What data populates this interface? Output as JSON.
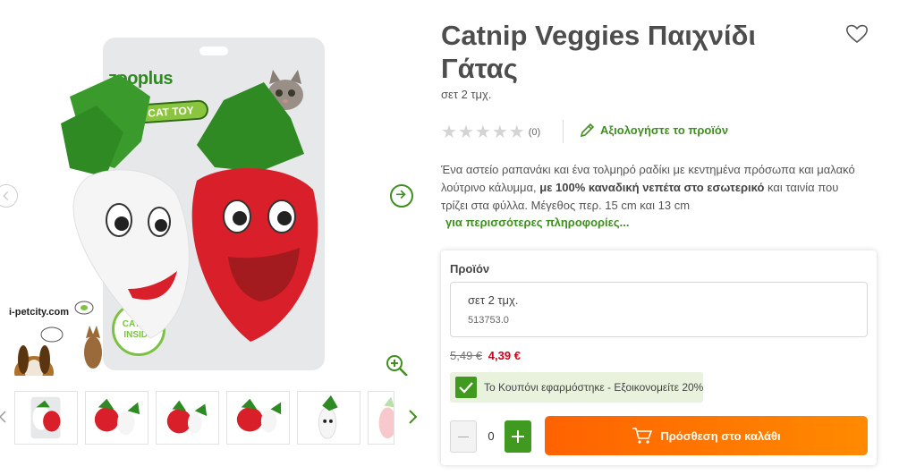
{
  "product": {
    "title": "Catnip Veggies Παιχνίδι Γάτας",
    "variant_subtitle": "σετ 2 τμχ.",
    "rating_count": "(0)",
    "review_link": "Αξιολογήστε το προϊόν",
    "description_part1": "Ένα αστείο ραπανάκι και ένα τολμηρό ραδίκι με κεντημένα πρόσωπα και μαλακό λούτρινο κάλυμμα, ",
    "description_bold": "με 100% καναδική νεπέτα στο εσωτερικό",
    "description_part2": " και ταινία που τρίζει στα φύλλα. Μέγεθος περ. 15 cm και 13 cm",
    "more_link": "για περισσότερες πληροφορίες..."
  },
  "image": {
    "brand_logo": "zooplus",
    "cat_toy_badge": "CAT TOY",
    "catnip_badge": "CATNIP INSIDE",
    "overlay_site": "i-petcity.com"
  },
  "buybox": {
    "label": "Προϊόν",
    "variant_name": "σετ 2 τμχ.",
    "variant_code": "513753.0",
    "price_old": "5,49 €",
    "price_new": "4,39 €",
    "coupon_text": "Το Κουπόνι εφαρμόστηκε - Εξοικονομείτε 20%",
    "quantity": "0",
    "add_to_cart": "Πρόσθεση στο καλάθι"
  },
  "colors": {
    "accent_green": "#3f8f1f",
    "price_red": "#d2001a",
    "cart_orange": "#ff6200"
  },
  "icons": [
    "heart-icon",
    "star-icon",
    "pencil-icon",
    "arrow-right-icon",
    "arrow-left-icon",
    "zoom-in-icon",
    "chevron-right-icon",
    "chevron-left-icon",
    "check-icon",
    "plus-icon",
    "minus-icon",
    "cart-icon"
  ]
}
